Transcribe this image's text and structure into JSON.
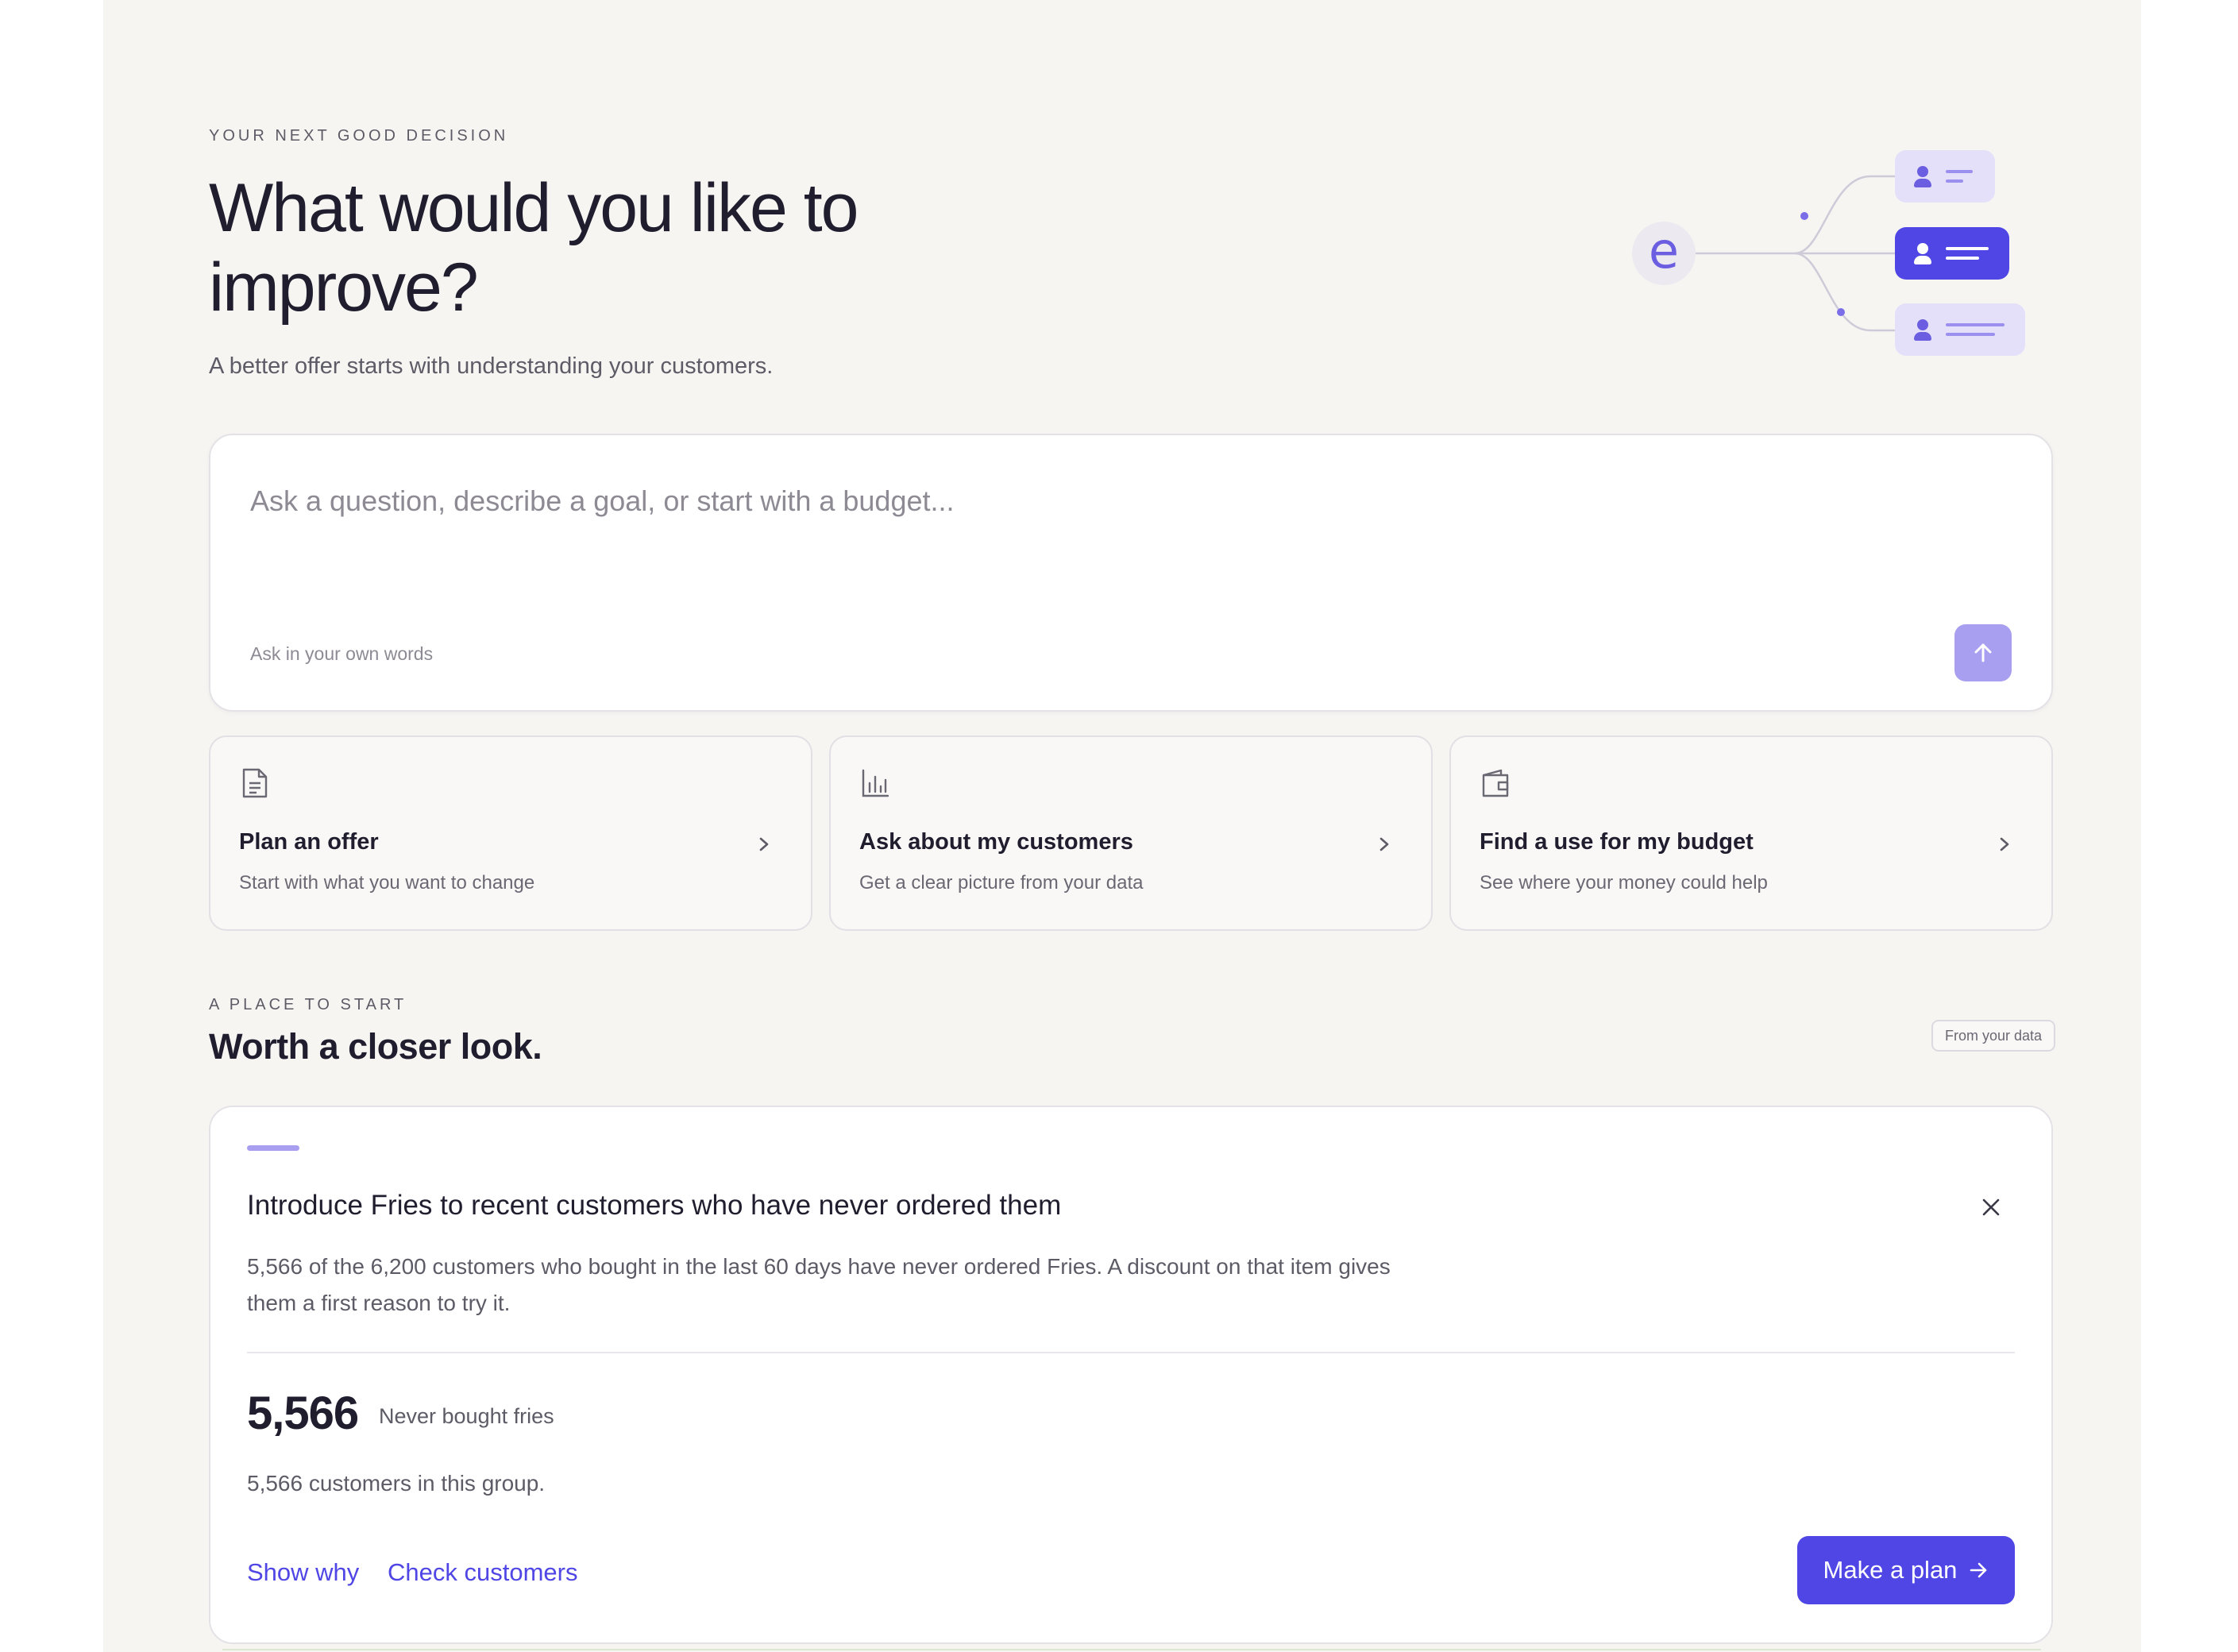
{
  "hero": {
    "eyebrow": "YOUR NEXT GOOD DECISION",
    "title": "What would you like to improve?",
    "subtitle": "A better offer starts with understanding your customers."
  },
  "illustration": {
    "logo_glyph": "e",
    "nodes": [
      {
        "name": "user-node",
        "active": false
      },
      {
        "name": "user-node",
        "active": true
      },
      {
        "name": "user-node",
        "active": false
      }
    ]
  },
  "prompt": {
    "value": "",
    "placeholder": "Ask a question, describe a goal, or start with a budget...",
    "hint": "Ask in your own words",
    "send_icon": "arrow-up-icon"
  },
  "actions": [
    {
      "icon": "document-icon",
      "title": "Plan an offer",
      "description": "Start with what you want to change"
    },
    {
      "icon": "bar-chart-icon",
      "title": "Ask about my customers",
      "description": "Get a clear picture from your data"
    },
    {
      "icon": "wallet-icon",
      "title": "Find a use for my budget",
      "description": "See where your money could help"
    }
  ],
  "section": {
    "eyebrow": "A PLACE TO START",
    "title": "Worth a closer look.",
    "badge": "From your data"
  },
  "insight": {
    "title": "Introduce Fries to recent customers who have never ordered them",
    "body": "5,566 of the 6,200 customers who bought in the last 60 days have never ordered Fries. A discount on that item gives them a first reason to try it.",
    "metric_value": "5,566",
    "metric_label": "Never bought fries",
    "metric_note": "5,566 customers in this group.",
    "link_show_why": "Show why",
    "link_check_customers": "Check customers",
    "primary_action": "Make a plan"
  },
  "colors": {
    "accent": "#4f46e5",
    "accent_soft": "#a89ff0",
    "accent_tint": "#e4e0fa",
    "background": "#f6f5f2",
    "text": "#1f1d2e",
    "muted": "#5d5b66"
  }
}
